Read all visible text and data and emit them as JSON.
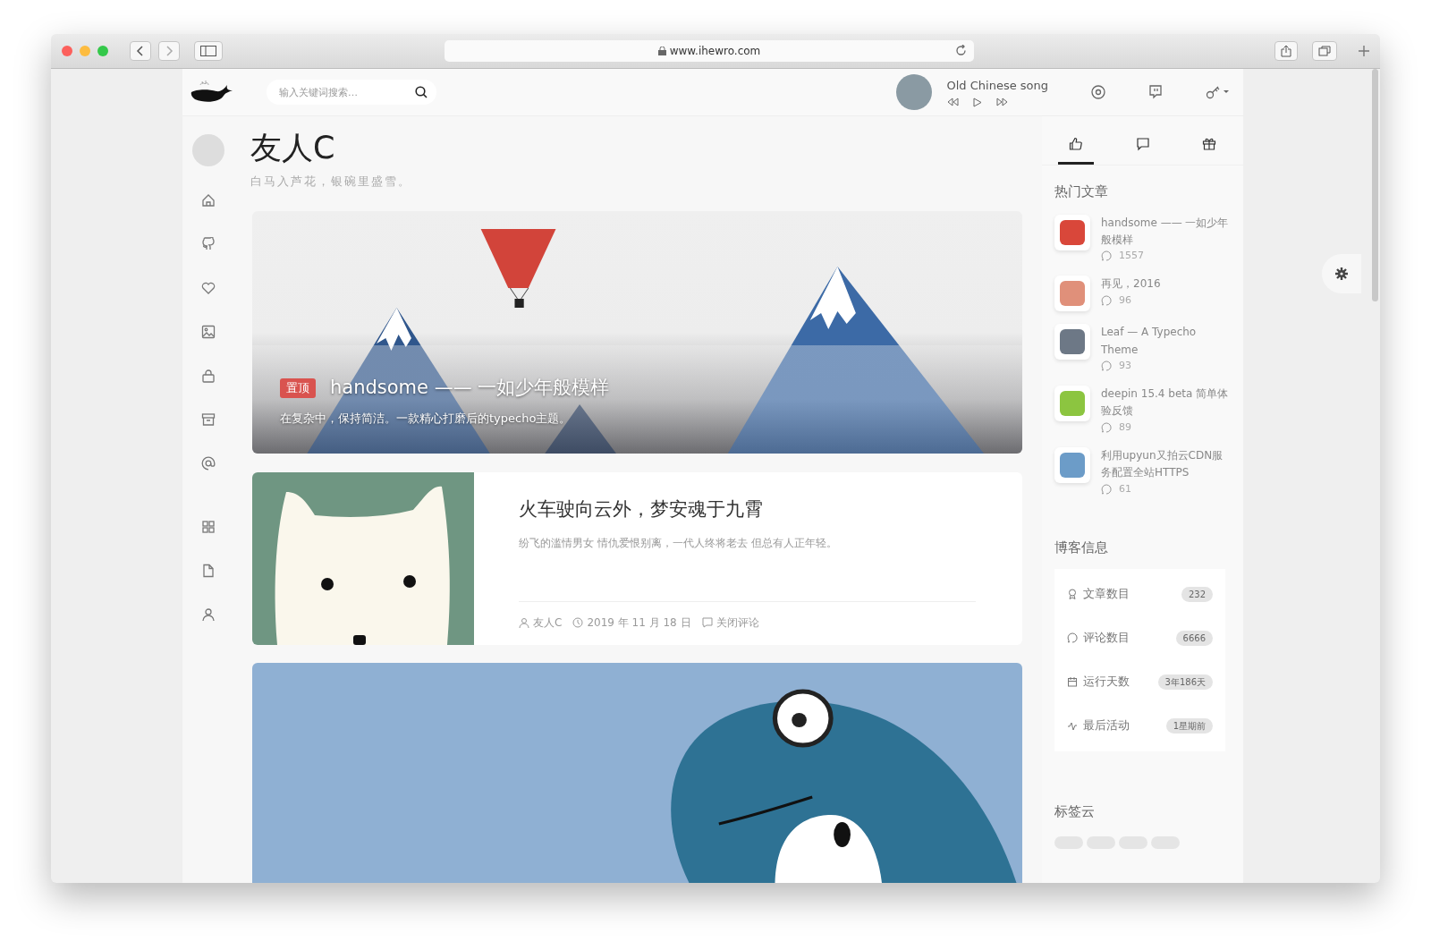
{
  "browser": {
    "url": "www.ihewro.com"
  },
  "header": {
    "search_placeholder": "输入关键词搜索…",
    "music_title": "Old Chinese song"
  },
  "blog": {
    "title": "友人C",
    "subtitle": "白马入芦花，银碗里盛雪。"
  },
  "posts": [
    {
      "kind": "banner",
      "badge": "置顶",
      "title": "handsome —— 一如少年般模样",
      "excerpt": "在复杂中，保持简洁。一款精心打磨后的typecho主题。"
    },
    {
      "kind": "card",
      "title": "火车驶向云外，梦安魂于九霄",
      "excerpt": "纷飞的滥情男女 情仇爱恨别离，一代人终将老去 但总有人正年轻。",
      "author": "友人C",
      "date": "2019 年 11 月 18 日",
      "comments": "关闭评论"
    },
    {
      "kind": "image"
    }
  ],
  "sidebar_tabs": [
    {
      "kind": "like",
      "selected": true
    },
    {
      "kind": "comment",
      "selected": false
    },
    {
      "kind": "gift",
      "selected": false
    }
  ],
  "hot_heading": "热门文章",
  "hot_posts": [
    {
      "title": "handsome —— 一如少年般模样",
      "comments": "1557",
      "color": "#d9473a"
    },
    {
      "title": "再见，2016",
      "comments": "96",
      "color": "#e0907a"
    },
    {
      "title": "Leaf — A Typecho Theme",
      "comments": "93",
      "color": "#6d7886"
    },
    {
      "title": "deepin 15.4 beta 简单体验反馈",
      "comments": "89",
      "color": "#8cc540"
    },
    {
      "title": "利用upyun又拍云CDN服务配置全站HTTPS",
      "comments": "61",
      "color": "#6c9cc8"
    }
  ],
  "info_heading": "博客信息",
  "blog_info": [
    {
      "kind": "posts",
      "label": "文章数目",
      "value": "232"
    },
    {
      "kind": "comments",
      "label": "评论数目",
      "value": "6666"
    },
    {
      "kind": "days",
      "label": "运行天数",
      "value": "3年186天"
    },
    {
      "kind": "activity",
      "label": "最后活动",
      "value": "1星期前"
    }
  ],
  "tags_heading": "标签云"
}
